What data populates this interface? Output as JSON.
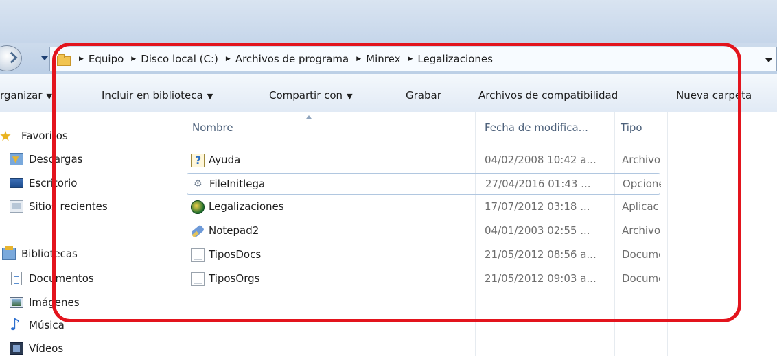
{
  "breadcrumb": {
    "items": [
      "Equipo",
      "Disco local (C:)",
      "Archivos de programa",
      "Minrex",
      "Legalizaciones"
    ]
  },
  "toolbar": {
    "organize": "rganizar",
    "include_library": "Incluir en biblioteca",
    "share_with": "Compartir con",
    "burn": "Grabar",
    "compat_files": "Archivos de compatibilidad",
    "new_folder": "Nueva carpeta"
  },
  "sidebar": {
    "favorites": "Favoritos",
    "downloads": "Descargas",
    "desktop": "Escritorio",
    "recent": "Sitios recientes",
    "libraries": "Bibliotecas",
    "documents": "Documentos",
    "images": "Imágenes",
    "music": "Música",
    "videos": "Vídeos"
  },
  "columns": {
    "name": "Nombre",
    "date": "Fecha de modifica...",
    "type": "Tipo"
  },
  "files": [
    {
      "name": "Ayuda",
      "date": "04/02/2008 10:42 a...",
      "type": "Archivo",
      "icon": "help-file-icon"
    },
    {
      "name": "FileInitlega",
      "date": "27/04/2016 01:43 ...",
      "type": "Opciones",
      "icon": "config-file-icon"
    },
    {
      "name": "Legalizaciones",
      "date": "17/07/2012 03:18 ...",
      "type": "Aplicación",
      "icon": "application-icon"
    },
    {
      "name": "Notepad2",
      "date": "04/01/2003 02:55 ...",
      "type": "Archivo",
      "icon": "notepad-icon"
    },
    {
      "name": "TiposDocs",
      "date": "21/05/2012 08:56 a...",
      "type": "Documento",
      "icon": "document-icon"
    },
    {
      "name": "TiposOrgs",
      "date": "21/05/2012 09:03 a...",
      "type": "Documento",
      "icon": "document-icon"
    }
  ],
  "colors": {
    "annotation": "#e3141d",
    "selection_border": "#b1c7e0"
  }
}
